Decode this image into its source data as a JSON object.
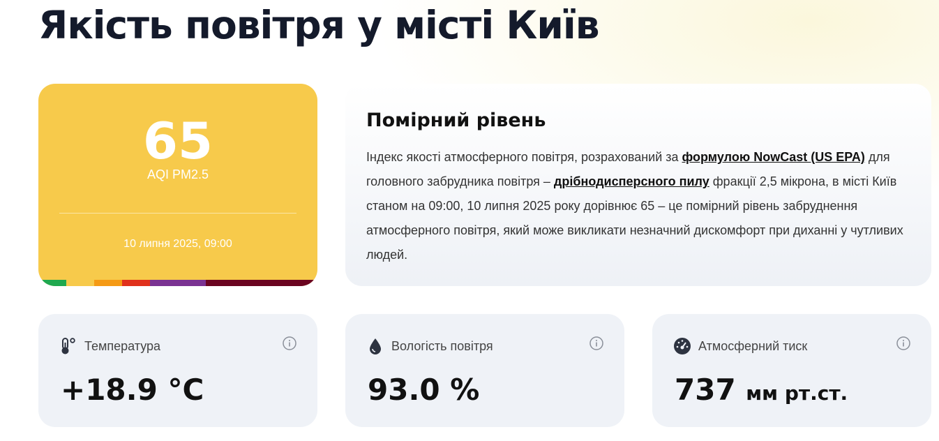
{
  "page_title": "Якість повітря у місті Київ",
  "aqi": {
    "value": "65",
    "unit": "AQI PM2.5",
    "timestamp": "10 липня 2025, 09:00",
    "card_color": "#f7ca4b",
    "scale_colors": [
      "#1fa84f",
      "#f7ca4b",
      "#f59a14",
      "#e0311c",
      "#7a3392",
      "#6b0420"
    ]
  },
  "description": {
    "title": "Помірний рівень",
    "text_1": "Індекс якості атмосферного повітря, розрахований за ",
    "link_1": "формулою NowCast (US EPA)",
    "text_2": " для головного забрудника повітря – ",
    "link_2": "дрібнодисперсного пилу",
    "text_3": " фракції 2,5 мікрона, в місті Київ станом на 09:00, 10 липня 2025 року дорівнює 65 – це помірний рівень забруднення атмосферного повітря, який може викликати незначний дискомфорт при диханні у чутливих людей."
  },
  "metrics": [
    {
      "icon": "thermometer-icon",
      "label": "Температура",
      "value": "+18.9 °C",
      "unit": ""
    },
    {
      "icon": "water-drop-icon",
      "label": "Вологість повітря",
      "value": "93.0 %",
      "unit": ""
    },
    {
      "icon": "gauge-icon",
      "label": "Атмосферний тиск",
      "value": "737",
      "unit": "мм рт.ст."
    }
  ]
}
